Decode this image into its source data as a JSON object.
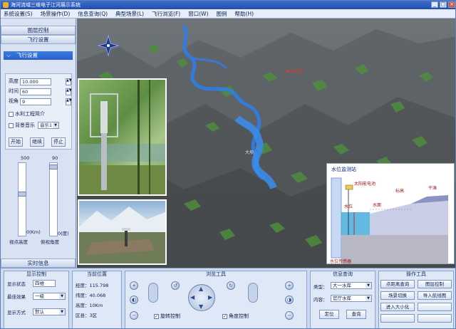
{
  "window": {
    "title": "海河流域三维电子江河展示系统"
  },
  "menu": [
    "系统设置(S)",
    "场景操作(D)",
    "信息查询(Q)",
    "典型场景(L)",
    "飞行浏览(F)",
    "窗口(W)",
    "图例",
    "帮助(H)"
  ],
  "left_panel": {
    "layer_control": "图层控制",
    "fly_settings": "飞行设置",
    "fly_settings_expanded": "飞行设置",
    "height_label": "高度",
    "height_value": "10.000",
    "time_label": "时间",
    "time_value": "60",
    "angle_label": "视角",
    "angle_value": "9",
    "water_project_label": "水利工程简介",
    "bg_music_label": "背景音乐",
    "music_value": "音乐1",
    "start": "开始",
    "continue": "继续",
    "stop": "停止",
    "slider_left_max": "500",
    "slider_right_max": "90",
    "slider_left_unit": "0(Km)",
    "slider_right_unit": "0(度)",
    "slider_left_caption": "视点高度",
    "slider_right_caption": "俯视角度",
    "realtime_info": "实时信息"
  },
  "scene": {
    "label_site": "水文站",
    "label_reservoir": "大坝",
    "diagram_title": "水位监测站",
    "diagram_solar": "太阳能电池",
    "diagram_elev": "标高",
    "diagram_dry": "干滩",
    "diagram_level": "水位",
    "diagram_surface": "水面",
    "diagram_sensor": "水位传感器"
  },
  "bottom": {
    "display": {
      "title": "显示控制",
      "show_status_label": "显示状态",
      "show_status_value": "四维",
      "best_effect_label": "最佳效果",
      "best_effect_value": "一级",
      "display_mode_label": "显示方式",
      "display_mode_value": "默认"
    },
    "position": {
      "title": "当前位置",
      "lon": "经度：115.798",
      "lat": "纬度：40.068",
      "alt": "高度：10Km",
      "zone": "区县：3区"
    },
    "browse": {
      "title": "浏览工具",
      "rotate_label": "旋转控制",
      "angle_label": "角度控制"
    },
    "query": {
      "title": "信息查询",
      "type_label": "类型：",
      "type_value": "大一水库",
      "content_label": "内容：",
      "content_value": "官厅水库",
      "locate_btn": "定位",
      "query_btn": "查询"
    },
    "tools": {
      "title": "操作工具",
      "btn1": "点距离查询",
      "btn2": "图层控制",
      "btn3": "场景切换",
      "btn4": "导入航线图",
      "btn5": "进入大小化",
      "btn6": "",
      "btn7": "",
      "btn8": ""
    }
  }
}
